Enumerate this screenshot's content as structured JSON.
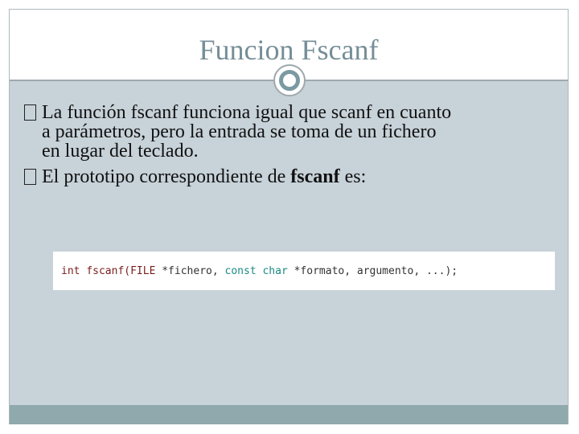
{
  "slide": {
    "title": "Funcion Fscanf",
    "bullets": [
      {
        "lines": [
          "La función fscanf funciona igual que scanf en cuanto",
          "a parámetros, pero la entrada se toma de un fichero",
          "en lugar del teclado."
        ]
      },
      {
        "text_before": "El prototipo correspondiente de ",
        "bold": "fscanf",
        "text_after": " es:"
      }
    ],
    "code": {
      "tokens": [
        "int ",
        "fscanf(FILE ",
        "*fichero, ",
        "const char ",
        "*formato, argumento, ...);"
      ]
    }
  },
  "colors": {
    "title": "#758e97",
    "content_bg": "#c7d2d9",
    "footer_bg": "#8fa9ad"
  }
}
